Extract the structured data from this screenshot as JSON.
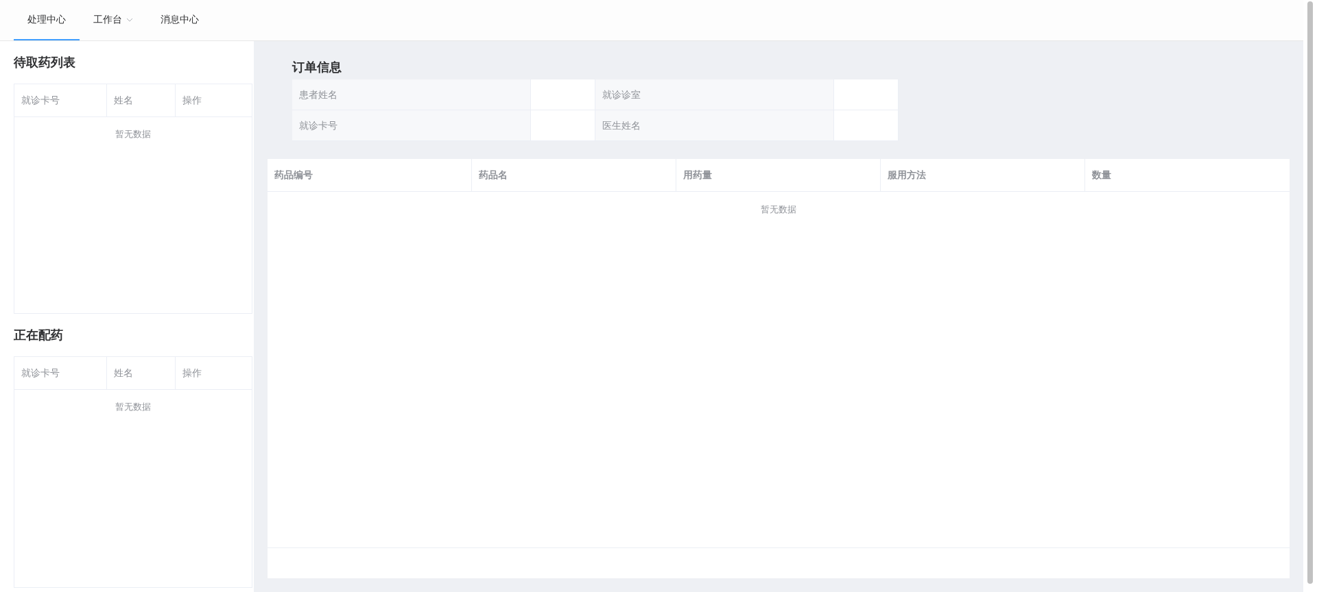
{
  "tabs": [
    {
      "label": "处理中心",
      "selected": true,
      "has_dropdown": false
    },
    {
      "label": "工作台",
      "selected": false,
      "has_dropdown": true
    },
    {
      "label": "消息中心",
      "selected": false,
      "has_dropdown": false
    }
  ],
  "pending_list": {
    "title": "待取药列表",
    "columns": [
      "就诊卡号",
      "姓名",
      "操作"
    ],
    "empty_text": "暂无数据"
  },
  "dispensing_list": {
    "title": "正在配药",
    "columns": [
      "就诊卡号",
      "姓名",
      "操作"
    ],
    "empty_text": "暂无数据"
  },
  "order_info": {
    "title": "订单信息",
    "fields": [
      {
        "label": "患者姓名"
      },
      {
        "label": "就诊诊室"
      },
      {
        "label": "就诊卡号"
      },
      {
        "label": "医生姓名"
      }
    ]
  },
  "drug_table": {
    "columns": [
      "药品编号",
      "药品名",
      "用药量",
      "服用方法",
      "数量"
    ],
    "empty_text": "暂无数据"
  }
}
